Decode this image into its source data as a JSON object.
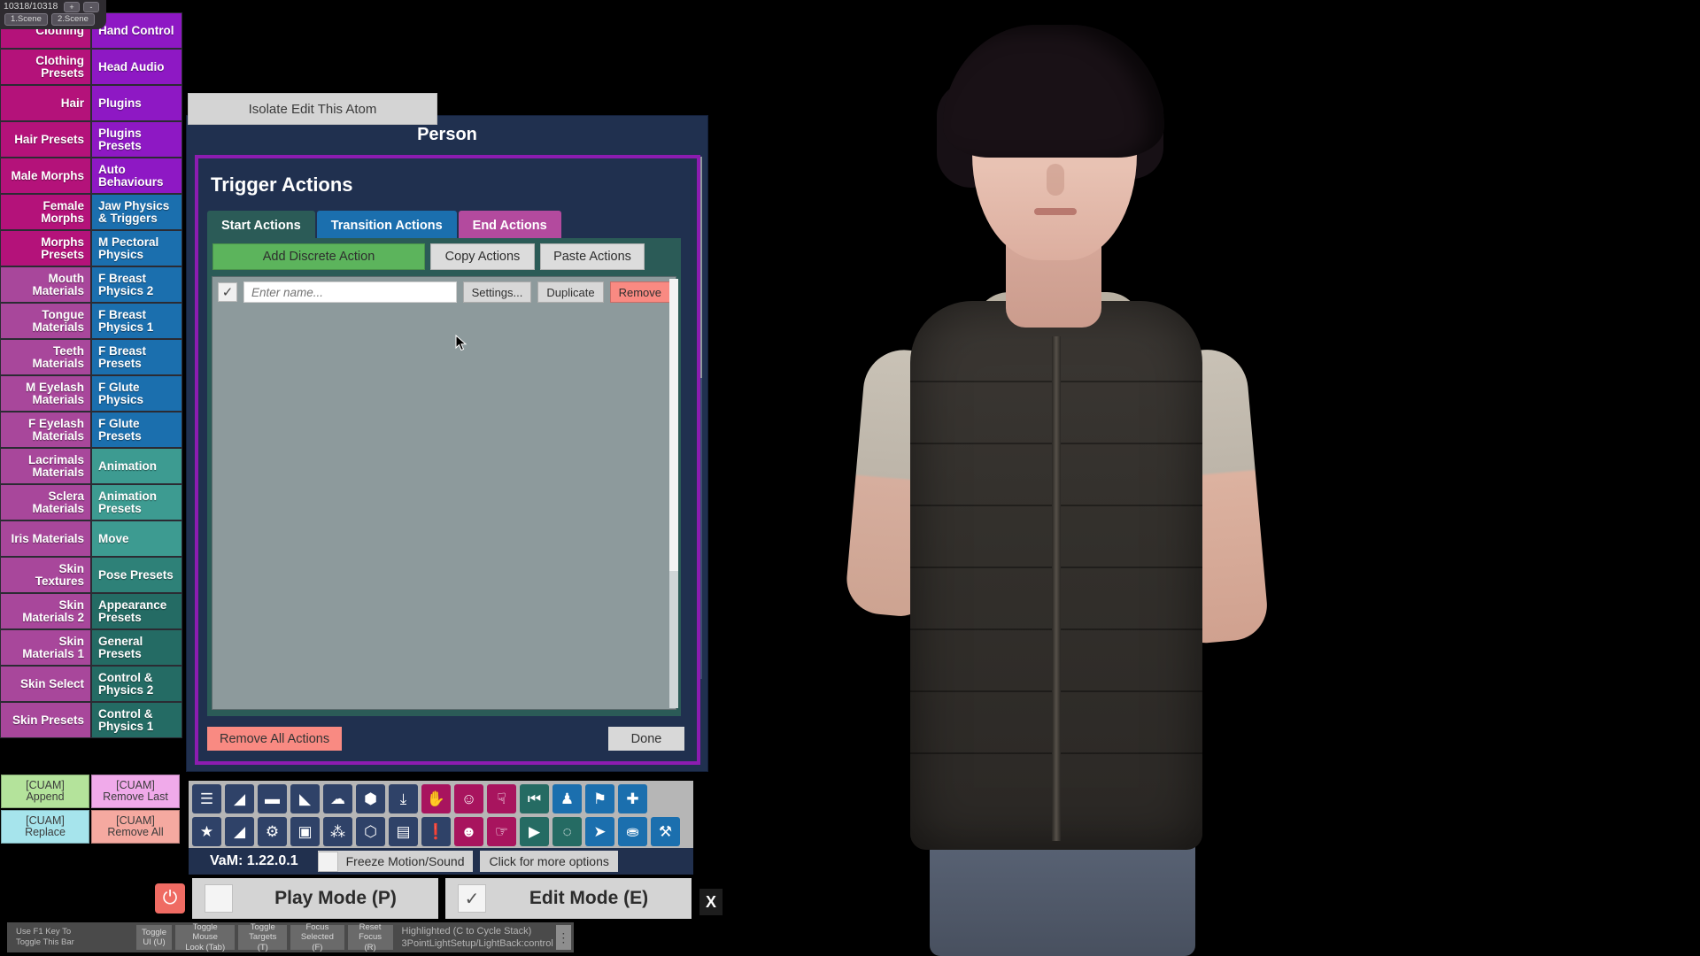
{
  "scene_header": {
    "counter": "10318/10318",
    "plus": "+",
    "minus": "-",
    "tabs": [
      "1.Scene",
      "2.Scene"
    ]
  },
  "sidebar": {
    "rows": [
      {
        "left": "Clothing",
        "left_color": "#b4127a",
        "right": "Hand Control",
        "right_color": "#8e18c4"
      },
      {
        "left": "Clothing Presets",
        "left_color": "#b4127a",
        "right": "Head Audio",
        "right_color": "#8e18c4"
      },
      {
        "left": "Hair",
        "left_color": "#b4127a",
        "right": "Plugins",
        "right_color": "#8e18c4"
      },
      {
        "left": "Hair Presets",
        "left_color": "#b4127a",
        "right": "Plugins Presets",
        "right_color": "#8e18c4"
      },
      {
        "left": "Male Morphs",
        "left_color": "#b4127a",
        "right": "Auto Behaviours",
        "right_color": "#8e18c4"
      },
      {
        "left": "Female Morphs",
        "left_color": "#b4127a",
        "right": "Jaw Physics & Triggers",
        "right_color": "#1b6fae"
      },
      {
        "left": "Morphs Presets",
        "left_color": "#b4127a",
        "right": "M Pectoral Physics",
        "right_color": "#1b6fae"
      },
      {
        "left": "Mouth Materials",
        "left_color": "#a8479b",
        "right": "F Breast Physics 2",
        "right_color": "#1b6fae"
      },
      {
        "left": "Tongue Materials",
        "left_color": "#a8479b",
        "right": "F Breast Physics 1",
        "right_color": "#1b6fae"
      },
      {
        "left": "Teeth Materials",
        "left_color": "#a8479b",
        "right": "F Breast Presets",
        "right_color": "#1b6fae"
      },
      {
        "left": "M Eyelash Materials",
        "left_color": "#a8479b",
        "right": "F Glute Physics",
        "right_color": "#1b6fae"
      },
      {
        "left": "F Eyelash Materials",
        "left_color": "#a8479b",
        "right": "F Glute Presets",
        "right_color": "#1b6fae"
      },
      {
        "left": "Lacrimals Materials",
        "left_color": "#a8479b",
        "right": "Animation",
        "right_color": "#3d9b91"
      },
      {
        "left": "Sclera Materials",
        "left_color": "#a8479b",
        "right": "Animation Presets",
        "right_color": "#3d9b91"
      },
      {
        "left": "Iris Materials",
        "left_color": "#a8479b",
        "right": "Move",
        "right_color": "#3d9b91"
      },
      {
        "left": "Skin Textures",
        "left_color": "#a8479b",
        "right": "Pose Presets",
        "right_color": "#2e8178"
      },
      {
        "left": "Skin Materials 2",
        "left_color": "#a8479b",
        "right": "Appearance Presets",
        "right_color": "#246b64"
      },
      {
        "left": "Skin Materials 1",
        "left_color": "#a8479b",
        "right": "General Presets",
        "right_color": "#246b64"
      },
      {
        "left": "Skin Select",
        "left_color": "#a8479b",
        "right": "Control & Physics 2",
        "right_color": "#246b64"
      },
      {
        "left": "Skin Presets",
        "left_color": "#a8479b",
        "right": "Control & Physics 1",
        "right_color": "#246b64"
      }
    ]
  },
  "cuam": {
    "buttons": [
      {
        "line1": "[CUAM]",
        "line2": "Append",
        "color": "#b4e39b"
      },
      {
        "line1": "[CUAM]",
        "line2": "Remove Last",
        "color": "#f0aaea"
      },
      {
        "line1": "[CUAM]",
        "line2": "Replace",
        "color": "#a6e4ec"
      },
      {
        "line1": "[CUAM]",
        "line2": "Remove All",
        "color": "#f5a9a0"
      }
    ]
  },
  "isolate_button": {
    "label": "Isolate Edit This Atom"
  },
  "person_panel": {
    "title": "Person",
    "trigger_title": "Trigger Actions",
    "tabs": [
      {
        "label": "Start Actions",
        "color": "#2b5b57",
        "active": true
      },
      {
        "label": "Transition Actions",
        "color": "#1b6fae",
        "active": false
      },
      {
        "label": "End Actions",
        "color": "#b34a9e",
        "active": false
      }
    ],
    "action_buttons": [
      {
        "label": "Add Discrete Action",
        "color": "#5cb45c"
      },
      {
        "label": "Copy Actions",
        "color": "#dcdcdc"
      },
      {
        "label": "Paste Actions",
        "color": "#dcdcdc"
      }
    ],
    "action_item": {
      "checked": "✓",
      "name_placeholder": "Enter name...",
      "name_value": "",
      "settings_label": "Settings...",
      "duplicate_label": "Duplicate",
      "remove_label": "Remove",
      "remove_color": "#f98a82"
    },
    "remove_all_label": "Remove All Actions",
    "done_label": "Done"
  },
  "toolbar": {
    "row1": [
      {
        "name": "menu-icon",
        "glyph": "☰",
        "color": "#2f4268"
      },
      {
        "name": "open-scene-icon",
        "glyph": "◢",
        "color": "#2f4268"
      },
      {
        "name": "folder-icon",
        "glyph": "▬",
        "color": "#2f4268"
      },
      {
        "name": "save-scene-icon",
        "glyph": "◣",
        "color": "#2f4268"
      },
      {
        "name": "cloud-download-icon",
        "glyph": "☁",
        "color": "#2f4268"
      },
      {
        "name": "package-icon",
        "glyph": "⬢",
        "color": "#2f4268"
      },
      {
        "name": "inbox-download-icon",
        "glyph": "⤓",
        "color": "#2f4268"
      },
      {
        "name": "hand-icon",
        "glyph": "✋",
        "color": "#a8145e"
      },
      {
        "name": "add-person-icon",
        "glyph": "☺",
        "color": "#a8145e"
      },
      {
        "name": "pinch-icon",
        "glyph": "☟",
        "color": "#a8145e"
      },
      {
        "name": "skip-back-icon",
        "glyph": "⏮",
        "color": "#256b63"
      },
      {
        "name": "person-icon",
        "glyph": "♟",
        "color": "#1b6fae"
      },
      {
        "name": "flag-icon",
        "glyph": "⚑",
        "color": "#1b6fae"
      },
      {
        "name": "move-cross-icon",
        "glyph": "✚",
        "color": "#1b6fae"
      }
    ],
    "row2": [
      {
        "name": "star-icon",
        "glyph": "★",
        "color": "#2f4268"
      },
      {
        "name": "load-preset-icon",
        "glyph": "◢",
        "color": "#2f4268"
      },
      {
        "name": "folder-settings-icon",
        "glyph": "⚙",
        "color": "#2f4268"
      },
      {
        "name": "camera-icon",
        "glyph": "▣",
        "color": "#2f4268"
      },
      {
        "name": "node-graph-icon",
        "glyph": "⁂",
        "color": "#2f4268"
      },
      {
        "name": "open-box-icon",
        "glyph": "⬡",
        "color": "#2f4268"
      },
      {
        "name": "clipboard-icon",
        "glyph": "▤",
        "color": "#2f4268"
      },
      {
        "name": "warning-icon",
        "glyph": "❗",
        "color": "#2f4268"
      },
      {
        "name": "remove-person-icon",
        "glyph": "☻",
        "color": "#a8145e"
      },
      {
        "name": "grab-icon",
        "glyph": "☞",
        "color": "#a8145e"
      },
      {
        "name": "play-icon",
        "glyph": "▶",
        "color": "#256b63"
      },
      {
        "name": "target-icon",
        "glyph": "◌",
        "color": "#256b63"
      },
      {
        "name": "cursor-icon",
        "glyph": "➤",
        "color": "#1b6fae"
      },
      {
        "name": "people-icon",
        "glyph": "⛂",
        "color": "#1b6fae"
      },
      {
        "name": "tools-icon",
        "glyph": "⚒",
        "color": "#1b6fae"
      }
    ]
  },
  "vam_bar": {
    "version": "VaM: 1.22.0.1",
    "freeze_label": "Freeze Motion/Sound",
    "freeze_checked": false,
    "more_options": "Click for more options"
  },
  "mode_bar": {
    "power_icon": "⏻",
    "play_mode": {
      "label": "Play Mode (P)",
      "checked": false
    },
    "edit_mode": {
      "label": "Edit Mode (E)",
      "checked": true,
      "check": "✓"
    },
    "close_label": "X"
  },
  "status_bar": {
    "hint_line1": "Use F1 Key To",
    "hint_line2": "Toggle This Bar",
    "buttons": [
      {
        "line1": "Toggle",
        "line2": "UI (U)"
      },
      {
        "line1": "Toggle Mouse",
        "line2": "Look (Tab)"
      },
      {
        "line1": "Toggle",
        "line2": "Targets (T)"
      },
      {
        "line1": "Focus",
        "line2": "Selected (F)"
      },
      {
        "line1": "Reset",
        "line2": "Focus (R)"
      }
    ],
    "info_line1": "Highlighted (C to Cycle Stack)",
    "info_line2": "3PointLightSetup/LightBack:control",
    "menu_dots": "⋮"
  }
}
